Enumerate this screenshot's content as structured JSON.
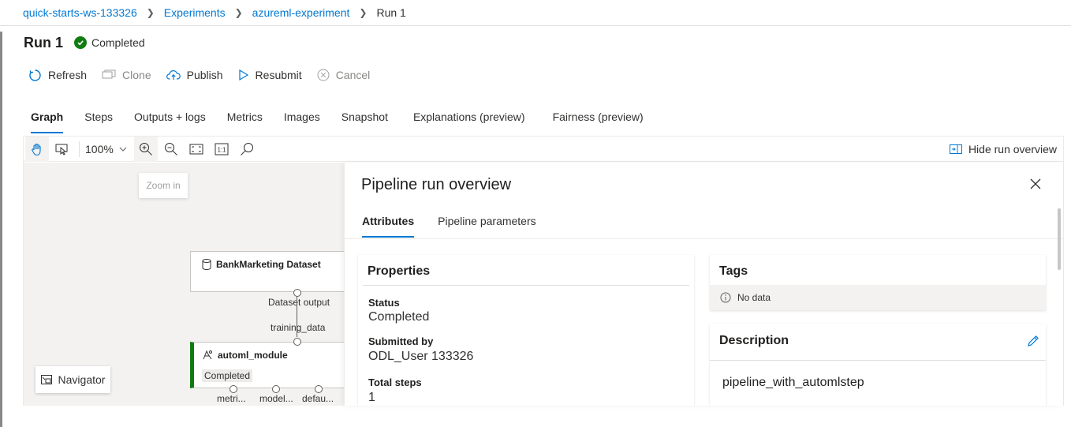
{
  "breadcrumb": {
    "workspace": "quick-starts-ws-133326",
    "experiments": "Experiments",
    "experiment": "azureml-experiment",
    "current": "Run 1"
  },
  "run": {
    "title": "Run 1",
    "status": "Completed",
    "status_color": "#107c10"
  },
  "commands": {
    "refresh": "Refresh",
    "clone": "Clone",
    "publish": "Publish",
    "resubmit": "Resubmit",
    "cancel": "Cancel"
  },
  "tabs": [
    {
      "label": "Graph",
      "active": true
    },
    {
      "label": "Steps"
    },
    {
      "label": "Outputs + logs"
    },
    {
      "label": "Metrics"
    },
    {
      "label": "Images"
    },
    {
      "label": "Snapshot"
    },
    {
      "label": "Explanations (preview)"
    },
    {
      "label": "Fairness (preview)"
    }
  ],
  "graph_toolbar": {
    "zoom": "100%",
    "tooltip": "Zoom in",
    "hide_overview": "Hide run overview"
  },
  "graph": {
    "dataset_node": {
      "title": "BankMarketing Dataset",
      "output_port": "Dataset output"
    },
    "edge_label": "training_data",
    "automl_node": {
      "title": "automl_module",
      "status": "Completed",
      "outputs": [
        "metri...",
        "model...",
        "defau..."
      ]
    },
    "navigator": "Navigator"
  },
  "overview": {
    "title": "Pipeline run overview",
    "tabs": [
      {
        "label": "Attributes",
        "active": true
      },
      {
        "label": "Pipeline parameters"
      }
    ],
    "properties": {
      "header": "Properties",
      "status_label": "Status",
      "status_value": "Completed",
      "submitted_by_label": "Submitted by",
      "submitted_by_value": "ODL_User 133326",
      "total_steps_label": "Total steps",
      "total_steps_value": "1"
    },
    "tags": {
      "header": "Tags",
      "empty": "No data"
    },
    "description": {
      "header": "Description",
      "value": "pipeline_with_automlstep"
    }
  },
  "colors": {
    "accent": "#0078d4",
    "success": "#107c10"
  }
}
